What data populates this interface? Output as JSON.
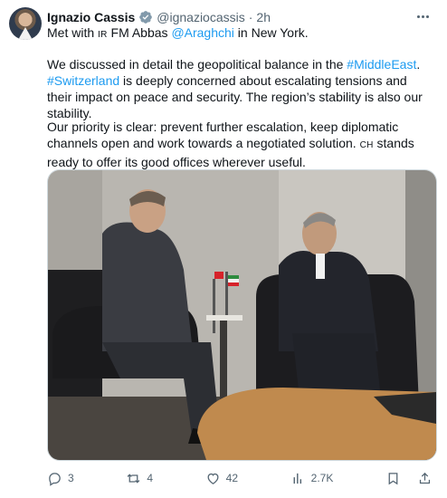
{
  "post": {
    "author_name": "Ignazio Cassis",
    "handle": "@ignaziocassis",
    "separator": "·",
    "time": "2h",
    "line1": {
      "a": "Met with ",
      "ir": "IR",
      "b": " FM Abbas ",
      "mention": "@Araghchi",
      "c": " in New York."
    },
    "para2": {
      "a": "We discussed in detail the geopolitical balance in the ",
      "tag1": "#MiddleEast",
      "b": ".",
      "tag2": "#Switzerland",
      "c": " is deeply concerned about escalating tensions and their impact on peace and security. The region’s stability is also our stability."
    },
    "para3": {
      "a": "Our priority is clear: prevent further escalation, keep diplomatic channels open and work towards a negotiated solution. ",
      "ch": "CH",
      "b": " stands ready to offer its good offices wherever useful."
    }
  },
  "actions": {
    "replies": "3",
    "reposts": "4",
    "likes": "42",
    "views": "2.7K"
  },
  "colors": {
    "link": "#1d9bf0",
    "secondary_text": "#536471",
    "verified_badge": "#829aab"
  }
}
